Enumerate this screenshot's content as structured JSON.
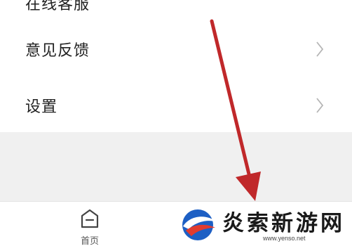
{
  "menu": {
    "items": [
      {
        "label": "在线客服"
      },
      {
        "label": "意见反馈"
      },
      {
        "label": "设置"
      }
    ]
  },
  "tabbar": {
    "home": {
      "label": "首页",
      "icon": "home-icon"
    }
  },
  "annotation": {
    "arrow_color": "#c0282a",
    "direction": "down"
  },
  "watermark": {
    "title": "炎索新游网",
    "url": "www.yenso.net",
    "logo_colors": [
      "#1d5fc4",
      "#e23b2e",
      "#ffffff"
    ]
  }
}
